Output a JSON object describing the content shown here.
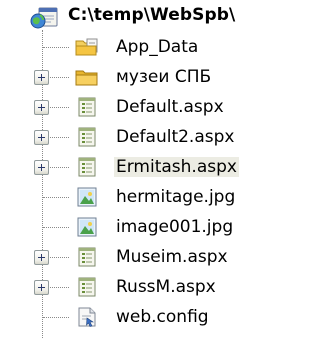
{
  "root": {
    "label": "C:\\temp\\WebSpb\\",
    "icon": "website-project-icon"
  },
  "items": [
    {
      "label": "App_Data",
      "icon": "special-folder-icon",
      "expandable": false
    },
    {
      "label": "музеи СПБ",
      "icon": "folder-icon",
      "expandable": true
    },
    {
      "label": "Default.aspx",
      "icon": "aspx-page-icon",
      "expandable": true
    },
    {
      "label": "Default2.aspx",
      "icon": "aspx-page-icon",
      "expandable": true
    },
    {
      "label": "Ermitash.aspx",
      "icon": "aspx-page-icon",
      "expandable": true,
      "selected": true
    },
    {
      "label": "hermitage.jpg",
      "icon": "image-file-icon",
      "expandable": false
    },
    {
      "label": "image001.jpg",
      "icon": "image-file-icon",
      "expandable": false
    },
    {
      "label": "Museim.aspx",
      "icon": "aspx-page-icon",
      "expandable": true
    },
    {
      "label": "RussM.aspx",
      "icon": "aspx-page-icon",
      "expandable": true
    },
    {
      "label": "web.config",
      "icon": "config-file-icon",
      "expandable": false
    }
  ],
  "colors": {
    "selection": "#ecece3",
    "tree_lines": "#8a8a8a",
    "folder": "#f5c542"
  }
}
